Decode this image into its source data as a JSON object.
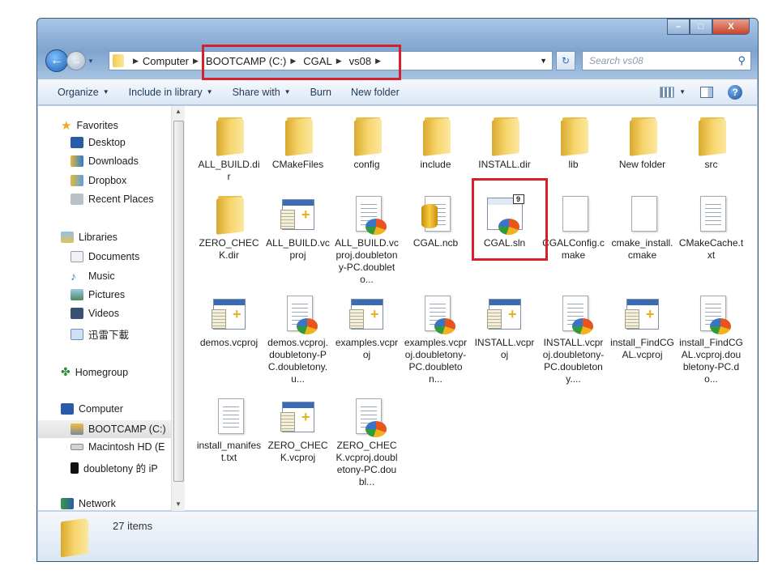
{
  "window": {
    "min": "–",
    "max": "□",
    "close": "X"
  },
  "address": {
    "crumbs": [
      "Computer",
      "BOOTCAMP (C:)",
      "CGAL",
      "vs08"
    ],
    "search_placeholder": "Search vs08"
  },
  "toolbar": {
    "organize": "Organize",
    "include": "Include in library",
    "share": "Share with",
    "burn": "Burn",
    "new_folder": "New folder",
    "help": "?"
  },
  "tree": {
    "favorites": "Favorites",
    "desktop": "Desktop",
    "downloads": "Downloads",
    "dropbox": "Dropbox",
    "recent": "Recent Places",
    "libraries": "Libraries",
    "documents": "Documents",
    "music": "Music",
    "pictures": "Pictures",
    "videos": "Videos",
    "xunlei": "迅雷下載",
    "homegroup": "Homegroup",
    "computer": "Computer",
    "bootcamp": "BOOTCAMP (C:)",
    "mac": "Macintosh HD (E",
    "iphone": "doubletony 的 iP",
    "network": "Network"
  },
  "files": [
    {
      "name": "ALL_BUILD.dir",
      "type": "folder"
    },
    {
      "name": "CMakeFiles",
      "type": "folder"
    },
    {
      "name": "config",
      "type": "folder"
    },
    {
      "name": "include",
      "type": "folder"
    },
    {
      "name": "INSTALL.dir",
      "type": "folder"
    },
    {
      "name": "lib",
      "type": "folder"
    },
    {
      "name": "New folder",
      "type": "folder"
    },
    {
      "name": "src",
      "type": "folder"
    },
    {
      "name": "ZERO_CHECK.dir",
      "type": "folder"
    },
    {
      "name": "ALL_BUILD.vcproj",
      "type": "vcproj"
    },
    {
      "name": "ALL_BUILD.vcproj.doubletony-PC.doubleto...",
      "type": "user"
    },
    {
      "name": "CGAL.ncb",
      "type": "ncb"
    },
    {
      "name": "CGAL.sln",
      "type": "sln",
      "badge": "9"
    },
    {
      "name": "CGALConfig.cmake",
      "type": "blank"
    },
    {
      "name": "cmake_install.cmake",
      "type": "blank"
    },
    {
      "name": "CMakeCache.txt",
      "type": "text"
    },
    {
      "name": "demos.vcproj",
      "type": "vcproj"
    },
    {
      "name": "demos.vcproj.doubletony-PC.doubletony.u...",
      "type": "user"
    },
    {
      "name": "examples.vcproj",
      "type": "vcproj"
    },
    {
      "name": "examples.vcproj.doubletony-PC.doubleton...",
      "type": "user"
    },
    {
      "name": "INSTALL.vcproj",
      "type": "vcproj"
    },
    {
      "name": "INSTALL.vcproj.doubletony-PC.doubletony....",
      "type": "user"
    },
    {
      "name": "install_FindCGAL.vcproj",
      "type": "vcproj"
    },
    {
      "name": "install_FindCGAL.vcproj.doubletony-PC.do...",
      "type": "user"
    },
    {
      "name": "install_manifest.txt",
      "type": "text"
    },
    {
      "name": "ZERO_CHECK.vcproj",
      "type": "vcproj"
    },
    {
      "name": "ZERO_CHECK.vcproj.doubletony-PC.doubl...",
      "type": "user"
    }
  ],
  "status": {
    "count": "27 items"
  },
  "colors": {
    "highlight": "#d6202c",
    "accent": "#3b6bb3"
  }
}
